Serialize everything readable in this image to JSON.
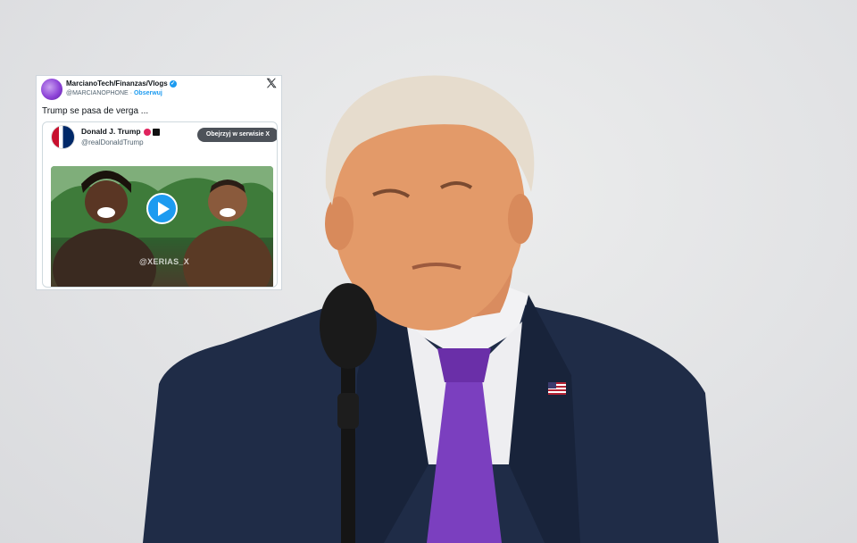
{
  "tweet": {
    "author_name": "MarcianoTech/Finanzas/Vlogs",
    "author_handle": "@MARCIANOPHONE",
    "separator": "·",
    "follow_label": "Obserwuj",
    "text": "Trump se pasa de verga ...",
    "quoted": {
      "author_name": "Donald J. Trump",
      "author_handle": "@realDonaldTrump",
      "view_button_label": "Obejrzyj w serwisie X",
      "video_watermark": "@XERIAS_X"
    }
  },
  "icons": {
    "verified": "verified-badge-icon",
    "close": "x-logo-icon",
    "play": "play-icon"
  },
  "colors": {
    "accent": "#1d9bf0",
    "text_primary": "#0f1419",
    "text_secondary": "#536471",
    "suit": "#1f2c47",
    "tie": "#7b3fbf"
  }
}
